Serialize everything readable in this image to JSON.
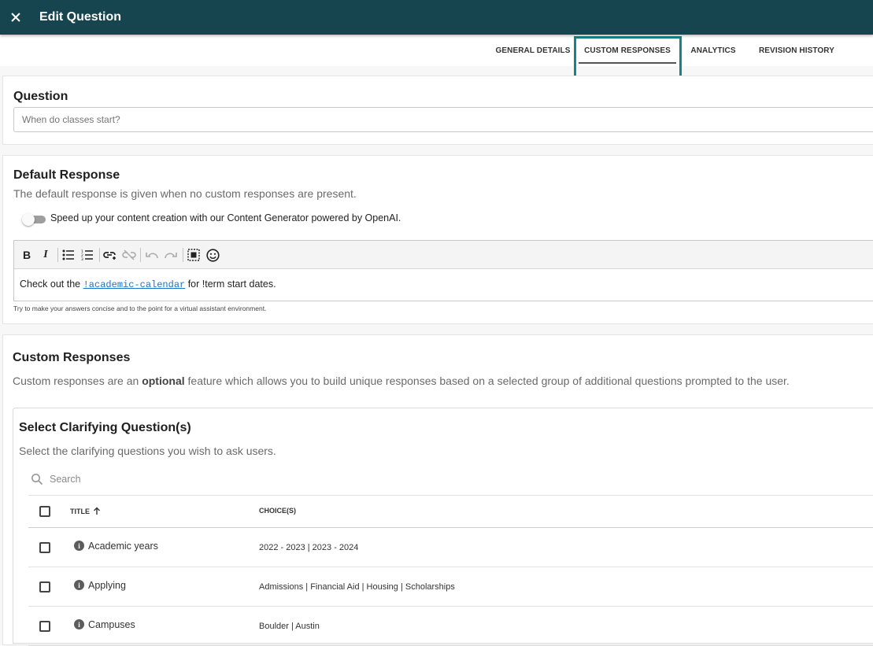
{
  "header": {
    "title": "Edit Question",
    "close_icon": "close-icon"
  },
  "tabs": [
    {
      "label": "GENERAL DETAILS"
    },
    {
      "label": "CUSTOM RESPONSES",
      "active": true
    },
    {
      "label": "ANALYTICS"
    },
    {
      "label": "REVISION HISTORY"
    }
  ],
  "question": {
    "heading": "Question",
    "placeholder": "When do classes start?"
  },
  "default_response": {
    "heading": "Default Response",
    "description": "The default response is given when no custom responses are present.",
    "toggle_label": "Speed up your content creation with our Content Generator powered by OpenAI.",
    "toggle_on": false,
    "toolbar": {
      "bold": "B",
      "italic": "I",
      "icons": [
        "bulleted-list-icon",
        "numbered-list-icon",
        "insert-link-icon",
        "unlink-icon",
        "undo-icon",
        "redo-icon",
        "select-all-icon",
        "emoji-icon"
      ]
    },
    "body_prefix": "Check out the ",
    "body_link": "!academic-calendar",
    "body_suffix": " for !term start dates.",
    "hint": "Try to make your answers concise and to the point for a virtual assistant environment."
  },
  "custom_responses": {
    "heading": "Custom Responses",
    "desc_prefix": "Custom responses are an ",
    "desc_bold": "optional",
    "desc_suffix": " feature which allows you to build unique responses based on a selected group of additional questions prompted to the user."
  },
  "clarifying": {
    "heading": "Select Clarifying Question(s)",
    "description": "Select the clarifying questions you wish to ask users.",
    "search_placeholder": "Search",
    "columns": {
      "title": "TITLE",
      "choices": "CHOICE(S)"
    },
    "rows": [
      {
        "title": "Academic years",
        "choices": "2022 - 2023 | 2023 - 2024"
      },
      {
        "title": "Applying",
        "choices": "Admissions | Financial Aid | Housing | Scholarships"
      },
      {
        "title": "Campuses",
        "choices": "Boulder | Austin"
      }
    ]
  },
  "colors": {
    "header_bg": "#17454f",
    "highlight": "#148487",
    "link": "#1a73c8"
  }
}
